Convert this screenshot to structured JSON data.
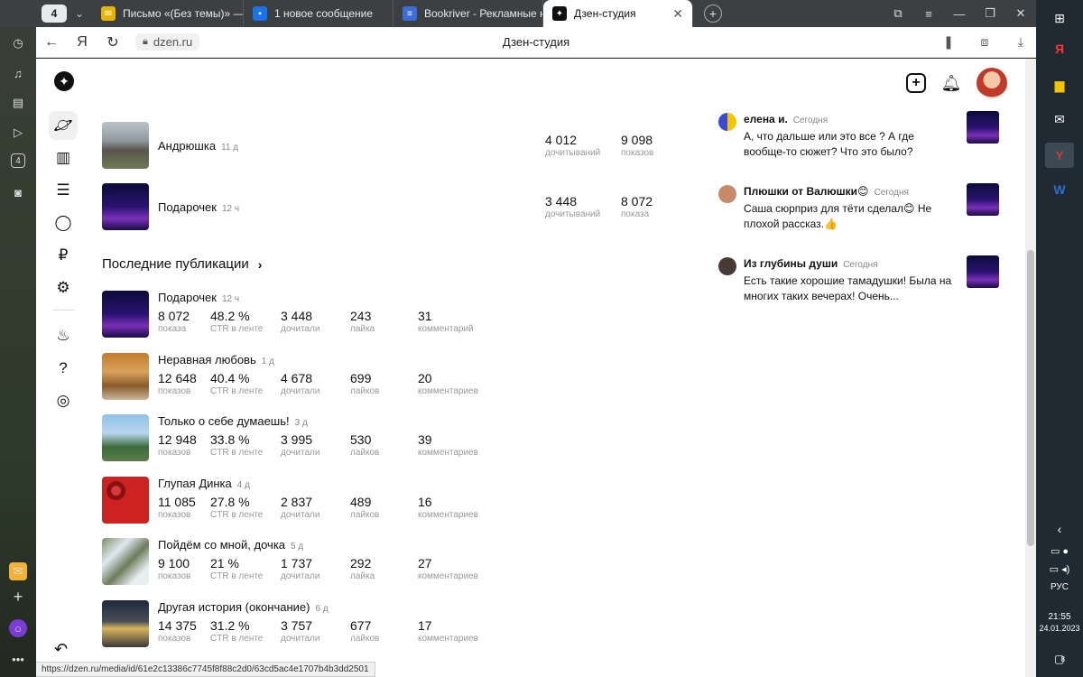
{
  "browser": {
    "tab_count": "4",
    "tabs": [
      {
        "label": "Письмо «(Без темы)» — M",
        "color": "#e8b400",
        "glyph": "✉"
      },
      {
        "label": "1 новое сообщение",
        "color": "#1a73e8",
        "glyph": "▪"
      },
      {
        "label": "Bookriver - Рекламные ка",
        "color": "#3b6fd8",
        "glyph": "≡"
      },
      {
        "label": "Дзен-студия",
        "color": "#111111",
        "glyph": "✦"
      }
    ],
    "url": "dzen.ru",
    "page_title": "Дзен-студия",
    "status_url": "https://dzen.ru/media/id/61e2c13386c7745f8f88c2d0/63cd5ac4e1707b4b3dd2501"
  },
  "top_publications": [
    {
      "title": "Андрюшка",
      "age": "11 д",
      "reads": "4 012",
      "reads_label": "дочитываний",
      "views": "9 098",
      "views_label": "показов",
      "thumb": "house"
    },
    {
      "title": "Подарочек",
      "age": "12 ч",
      "reads": "3 448",
      "reads_label": "дочитываний",
      "views": "8 072",
      "views_label": "показа",
      "thumb": "night"
    }
  ],
  "recent": {
    "title": "Последние публикации",
    "items": [
      {
        "title": "Подарочек",
        "age": "12 ч",
        "views": "8 072",
        "views_label": "показа",
        "ctr": "48.2 %",
        "ctr_label": "CTR в ленте",
        "reads": "3 448",
        "reads_label": "дочитали",
        "likes": "243",
        "likes_label": "лайка",
        "comments": "31",
        "comments_label": "комментарий",
        "thumb": "night"
      },
      {
        "title": "Неравная любовь",
        "age": "1 д",
        "views": "12 648",
        "views_label": "показов",
        "ctr": "40.4 %",
        "ctr_label": "CTR в ленте",
        "reads": "4 678",
        "reads_label": "дочитали",
        "likes": "699",
        "likes_label": "лайков",
        "comments": "20",
        "comments_label": "комментариев",
        "thumb": "autumn"
      },
      {
        "title": "Только о себе думаешь!",
        "age": "3 д",
        "views": "12 948",
        "views_label": "показов",
        "ctr": "33.8 %",
        "ctr_label": "CTR в ленте",
        "reads": "3 995",
        "reads_label": "дочитали",
        "likes": "530",
        "likes_label": "лайков",
        "comments": "39",
        "comments_label": "комментариев",
        "thumb": "building"
      },
      {
        "title": "Глупая Динка",
        "age": "4 д",
        "views": "11 085",
        "views_label": "показов",
        "ctr": "27.8 %",
        "ctr_label": "CTR в ленте",
        "reads": "2 837",
        "reads_label": "дочитали",
        "likes": "489",
        "likes_label": "лайков",
        "comments": "16",
        "comments_label": "комментариев",
        "thumb": "berries"
      },
      {
        "title": "Пойдём со мной, дочка",
        "age": "5 д",
        "views": "9 100",
        "views_label": "показов",
        "ctr": "21 %",
        "ctr_label": "CTR в ленте",
        "reads": "1 737",
        "reads_label": "дочитали",
        "likes": "292",
        "likes_label": "лайка",
        "comments": "27",
        "comments_label": "комментариев",
        "thumb": "snow"
      },
      {
        "title": "Другая история (окончание)",
        "age": "6 д",
        "views": "14 375",
        "views_label": "показов",
        "ctr": "31.2 %",
        "ctr_label": "CTR в ленте",
        "reads": "3 757",
        "reads_label": "дочитали",
        "likes": "677",
        "likes_label": "лайков",
        "comments": "17",
        "comments_label": "комментариев",
        "thumb": "street"
      }
    ]
  },
  "comments": [
    {
      "author": "елена и.",
      "when": "Сегодня",
      "text": "А, что дальше или это все ? А где вообще-то сюжет? Что это было?",
      "avatar_color": "#f5c400"
    },
    {
      "author": "Плюшки от Валюшки😊",
      "when": "Сегодня",
      "text": "Саша сюрприз для тёти сделал😊 Не плохой рассказ.👍",
      "avatar_color": "#c98a6a"
    },
    {
      "author": "Из глубины души",
      "when": "Сегодня",
      "text": "Есть такие хорошие тамадушки! Была на многих таких вечерах! Очень...",
      "avatar_color": "#4a3a36"
    }
  ],
  "taskbar": {
    "lang": "РУС",
    "time": "21:55",
    "date": "24.01.2023",
    "notif_count": "8",
    "sidebar_badge": "4"
  }
}
